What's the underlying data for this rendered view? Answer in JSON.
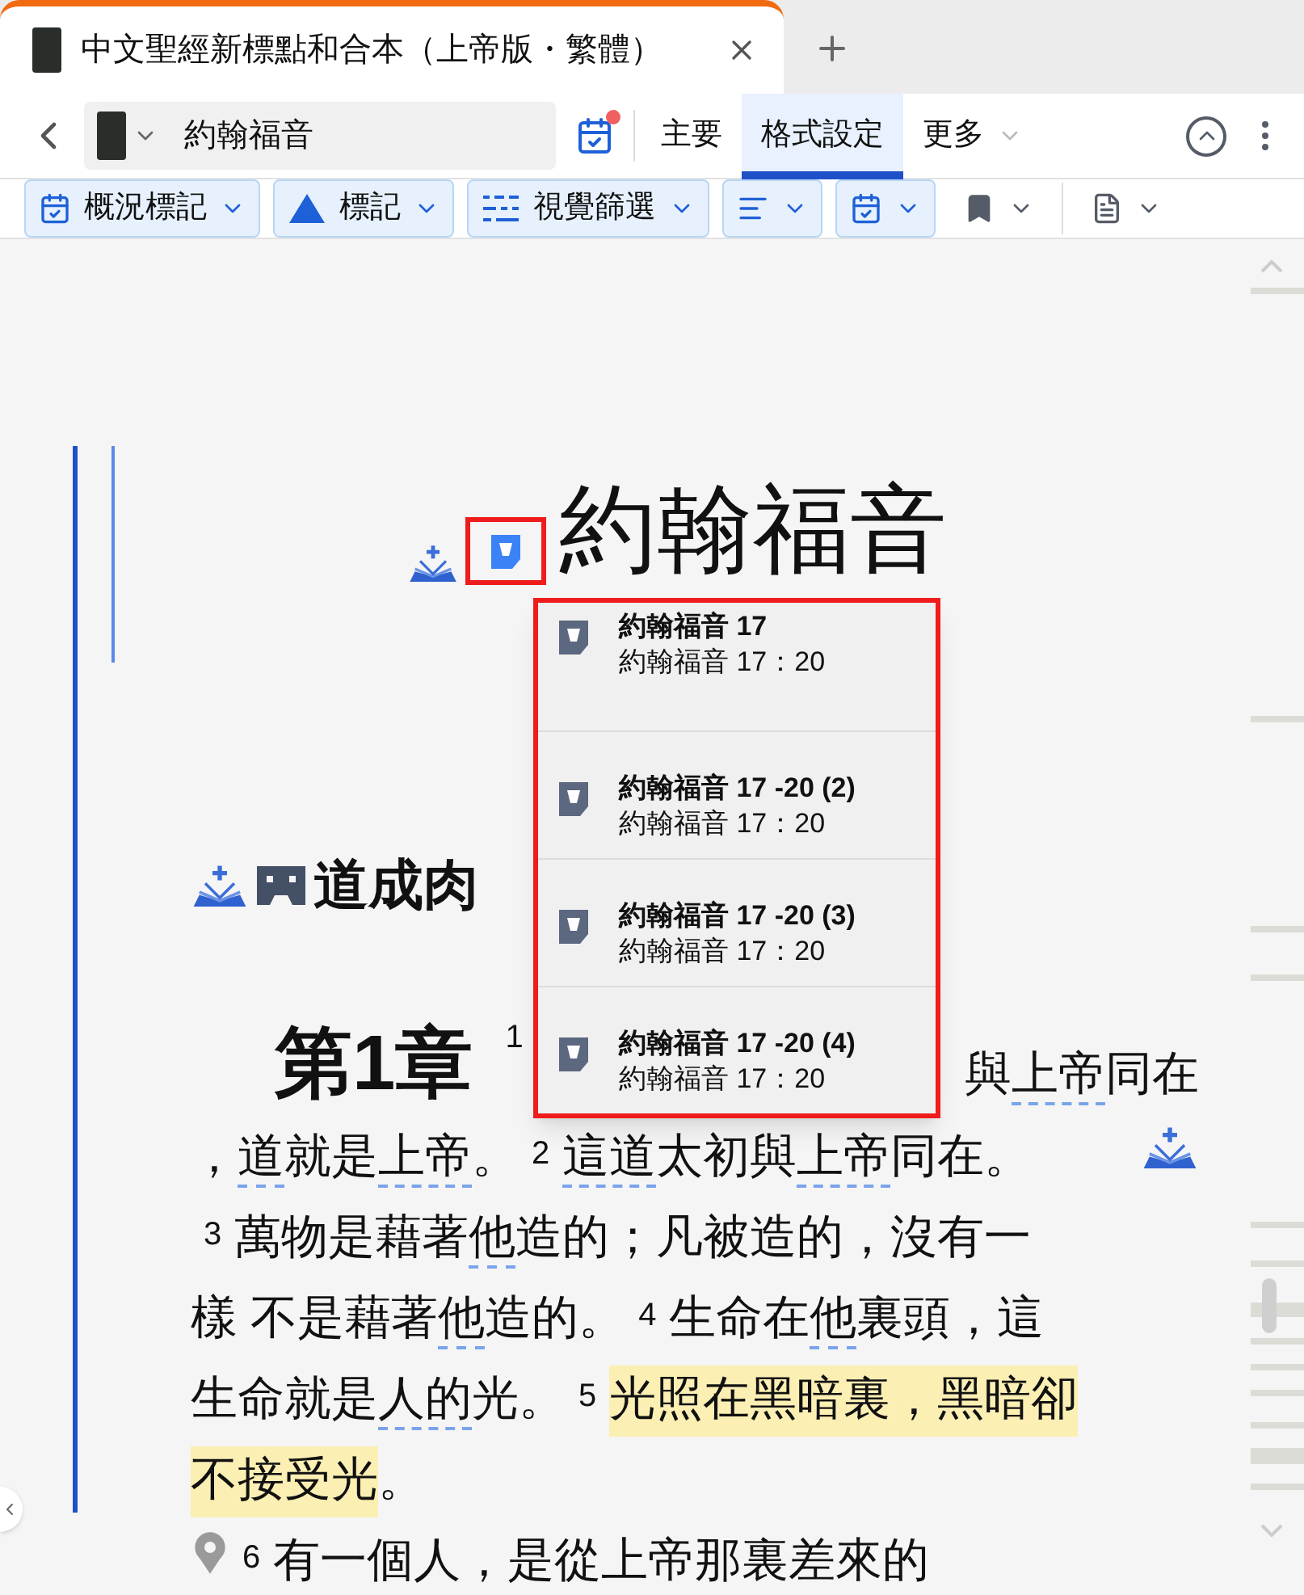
{
  "browser_tab": {
    "title": "中文聖經新標點和合本（上帝版・繁體）",
    "selected": true
  },
  "toolbar": {
    "book": "約翰福音",
    "notification": true,
    "tabs": [
      {
        "label": "主要",
        "selected": false
      },
      {
        "label": "格式設定",
        "selected": true
      },
      {
        "label": "更多",
        "selected": false,
        "dropdown": true
      }
    ]
  },
  "format_buttons": [
    {
      "label": "概況標記",
      "highlighted": true
    },
    {
      "label": "標記",
      "highlighted": true
    },
    {
      "label": "視覺篩選",
      "highlighted": true
    },
    {
      "highlighted": true
    },
    {
      "highlighted": true
    },
    {
      "highlighted": false
    },
    {
      "highlighted": false
    }
  ],
  "document": {
    "title": "約翰福音",
    "heading": "道成肉",
    "lines": [
      [
        {
          "kind": "chapter",
          "text": "第1章"
        },
        {
          "kind": "verse",
          "text": "1"
        },
        {
          "kind": "gap"
        },
        {
          "kind": "plain",
          "text": "與"
        },
        {
          "kind": "link",
          "text": "上帝"
        },
        {
          "kind": "plain",
          "text": "同在"
        }
      ],
      [
        {
          "kind": "plain",
          "text": "，"
        },
        {
          "kind": "link",
          "text": "道"
        },
        {
          "kind": "plain",
          "text": "就是"
        },
        {
          "kind": "link",
          "text": "上帝"
        },
        {
          "kind": "plain",
          "text": "。"
        },
        {
          "kind": "verse",
          "text": "2"
        },
        {
          "kind": "link",
          "text": "這道"
        },
        {
          "kind": "plain",
          "text": "太初與"
        },
        {
          "kind": "link",
          "text": "上帝"
        },
        {
          "kind": "plain",
          "text": "同在。"
        },
        {
          "kind": "icon"
        }
      ],
      [
        {
          "kind": "verse",
          "text": "3"
        },
        {
          "kind": "plain",
          "text": "萬物是藉著"
        },
        {
          "kind": "link",
          "text": "他"
        },
        {
          "kind": "plain",
          "text": "造的；凡被造的，沒有一"
        }
      ],
      [
        {
          "kind": "plain",
          "text": "樣 不是藉著"
        },
        {
          "kind": "link",
          "text": "他"
        },
        {
          "kind": "plain",
          "text": "造的。"
        },
        {
          "kind": "verse",
          "text": "4"
        },
        {
          "kind": "plain",
          "text": "生命在"
        },
        {
          "kind": "link",
          "text": "他"
        },
        {
          "kind": "plain",
          "text": "裏頭，這"
        }
      ],
      [
        {
          "kind": "plain",
          "text": "生命就是"
        },
        {
          "kind": "link",
          "text": "人的"
        },
        {
          "kind": "plain",
          "text": "光。"
        },
        {
          "kind": "verse",
          "text": "5"
        },
        {
          "kind": "highlight",
          "text": "光照在黑暗裏，黑暗卻"
        }
      ],
      [
        {
          "kind": "highlight",
          "text": "不接受光"
        },
        {
          "kind": "plain",
          "text": "。"
        }
      ],
      [
        {
          "kind": "pin"
        },
        {
          "kind": "verse",
          "text": "6"
        },
        {
          "kind": "plain",
          "text": "有一個人，是從上帝那裏差來的"
        }
      ]
    ]
  },
  "popup": {
    "items": [
      {
        "title": "約翰福音 17",
        "reference": "約翰福音 17：20"
      },
      {
        "title": "約翰福音 17 -20 (2)",
        "reference": "約翰福音 17：20"
      },
      {
        "title": "約翰福音 17 -20 (3)",
        "reference": "約翰福音 17：20"
      },
      {
        "title": "約翰福音 17 -20 (4)",
        "reference": "約翰福音 17：20"
      }
    ]
  }
}
